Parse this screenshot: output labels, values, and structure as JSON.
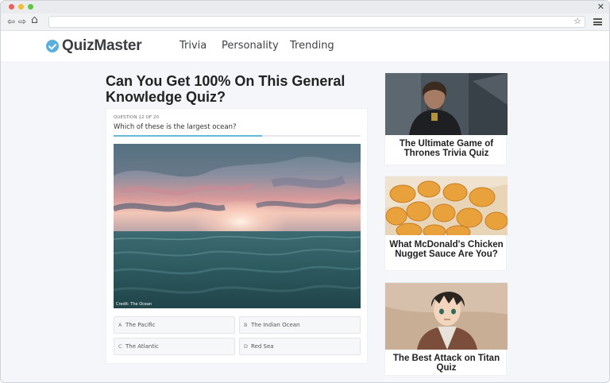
{
  "browser": {
    "close_symbol": "✕",
    "back_symbol": "⇦",
    "forward_symbol": "⇨",
    "home_symbol": "⌂",
    "star_symbol": "☆",
    "url": ""
  },
  "site": {
    "logo_text": "QuizMaster",
    "brand_color": "#5aaede",
    "nav": [
      {
        "label": "Trivia"
      },
      {
        "label": "Personality"
      },
      {
        "label": "Trending"
      }
    ]
  },
  "quiz": {
    "title": "Can You Get 100% On This General Knowledge Quiz?",
    "counter": "QUESTION 12 OF 20",
    "question": "Which of these is the largest ocean?",
    "progress": 0.6,
    "image_credit": "Credit: The Ocean",
    "answers": [
      {
        "letter": "A",
        "text": "The Pacific"
      },
      {
        "letter": "B",
        "text": "The Indian Ocean"
      },
      {
        "letter": "C",
        "text": "The Atlantic"
      },
      {
        "letter": "D",
        "text": "Red Sea"
      }
    ]
  },
  "sidebar": {
    "cards": [
      {
        "title": "The Ultimate Game of Thrones Trivia Quiz"
      },
      {
        "title": "What McDonald's Chicken Nugget Sauce Are You?"
      },
      {
        "title": "The Best Attack on Titan Quiz"
      }
    ]
  }
}
